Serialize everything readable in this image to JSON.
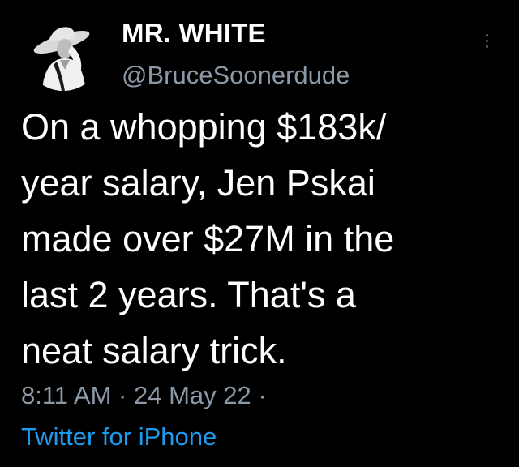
{
  "user": {
    "display_name": "MR. WHITE",
    "handle": "@BruceSoonerdude",
    "avatar_icon": "cowboy-portrait-avatar"
  },
  "tweet": {
    "text_lines": [
      "On a whopping $183k/",
      "year salary, Jen Pskai",
      "made over $27M in the",
      "last 2 years. That's a",
      "neat salary trick."
    ],
    "time": "8:11 AM",
    "separator": " · ",
    "date": "24 May 22",
    "trailing_separator": " ·",
    "source": "Twitter for iPhone"
  },
  "icons": {
    "more": "more-vertical-icon"
  },
  "colors": {
    "background": "#000000",
    "text": "#ffffff",
    "secondary": "#8b98a5",
    "link": "#1d9bf0"
  }
}
